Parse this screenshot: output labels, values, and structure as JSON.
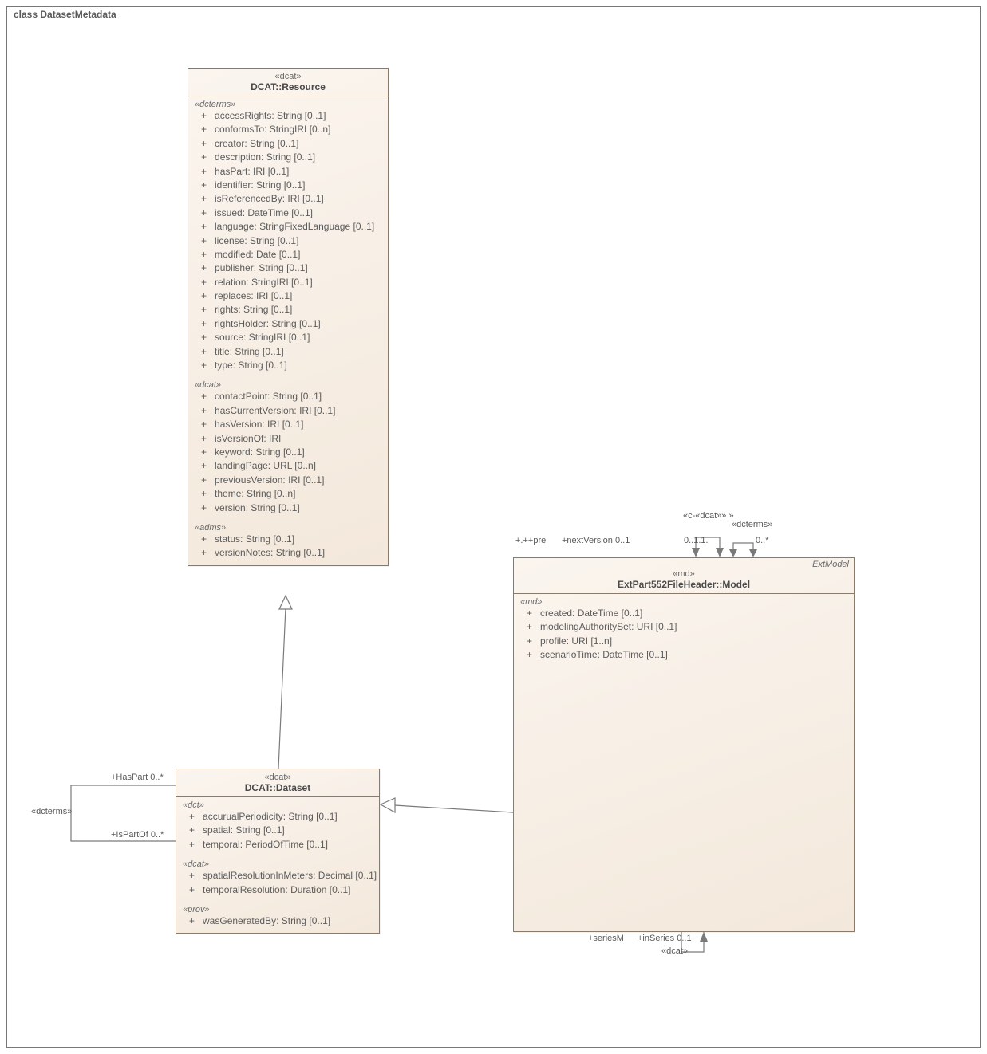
{
  "frame_title": "class DatasetMetadata",
  "resource": {
    "stereo": "«dcat»",
    "name": "DCAT::Resource",
    "g_dcterms": "«dcterms»",
    "dcterms": [
      "accessRights: String [0..1]",
      "conformsTo: StringIRI [0..n]",
      "creator: String [0..1]",
      "description: String [0..1]",
      "hasPart: IRI [0..1]",
      "identifier: String [0..1]",
      "isReferencedBy: IRI [0..1]",
      "issued: DateTime [0..1]",
      "language: StringFixedLanguage [0..1]",
      "license: String [0..1]",
      "modified: Date [0..1]",
      "publisher: String [0..1]",
      "relation: StringIRI [0..1]",
      "replaces: IRI [0..1]",
      "rights: String [0..1]",
      "rightsHolder: String [0..1]",
      "source: StringIRI [0..1]",
      "title: String [0..1]",
      "type: String [0..1]"
    ],
    "g_dcat": "«dcat»",
    "dcat": [
      "contactPoint: String [0..1]",
      "hasCurrentVersion: IRI [0..1]",
      "hasVersion: IRI [0..1]",
      "isVersionOf: IRI",
      "keyword: String [0..1]",
      "landingPage: URL [0..n]",
      "previousVersion: IRI [0..1]",
      "theme: String [0..n]",
      "version: String [0..1]"
    ],
    "g_adms": "«adms»",
    "adms": [
      "status: String [0..1]",
      "versionNotes: String [0..1]"
    ]
  },
  "dataset": {
    "stereo": "«dcat»",
    "name": "DCAT::Dataset",
    "g_dct": "«dct»",
    "dct": [
      "accurualPeriodicity: String [0..1]",
      "spatial: String [0..1]",
      "temporal: PeriodOfTime [0..1]"
    ],
    "g_dcat": "«dcat»",
    "dcat": [
      "spatialResolutionInMeters: Decimal [0..1]",
      "temporalResolution: Duration [0..1]"
    ],
    "g_prov": "«prov»",
    "prov": [
      "wasGeneratedBy: String [0..1]"
    ]
  },
  "model": {
    "corner": "ExtModel",
    "stereo": "«md»",
    "name": "ExtPart552FileHeader::Model",
    "g_md": "«md»",
    "md": [
      "created: DateTime [0..1]",
      "modelingAuthoritySet: URI [0..1]",
      "profile: URI [1..n]",
      "scenarioTime: DateTime [0..1]"
    ]
  },
  "labels": {
    "hasPart": "+HasPart 0..*",
    "isPartOf": "+IsPartOf 0..*",
    "dcterms_assoc": "«dcterms»",
    "pre_plus": "+.++pre",
    "nextVersion": "+nextVersion 0..1",
    "mult1": "0..1.1.",
    "mult2": "0..*",
    "dcat_top": "«c-«dcat»» »",
    "dcterms_top": "«dcterms»",
    "seriesM": "+seriesM",
    "inSeries": "+inSeries 0..1",
    "dcat_bottom": "«dcat»"
  }
}
